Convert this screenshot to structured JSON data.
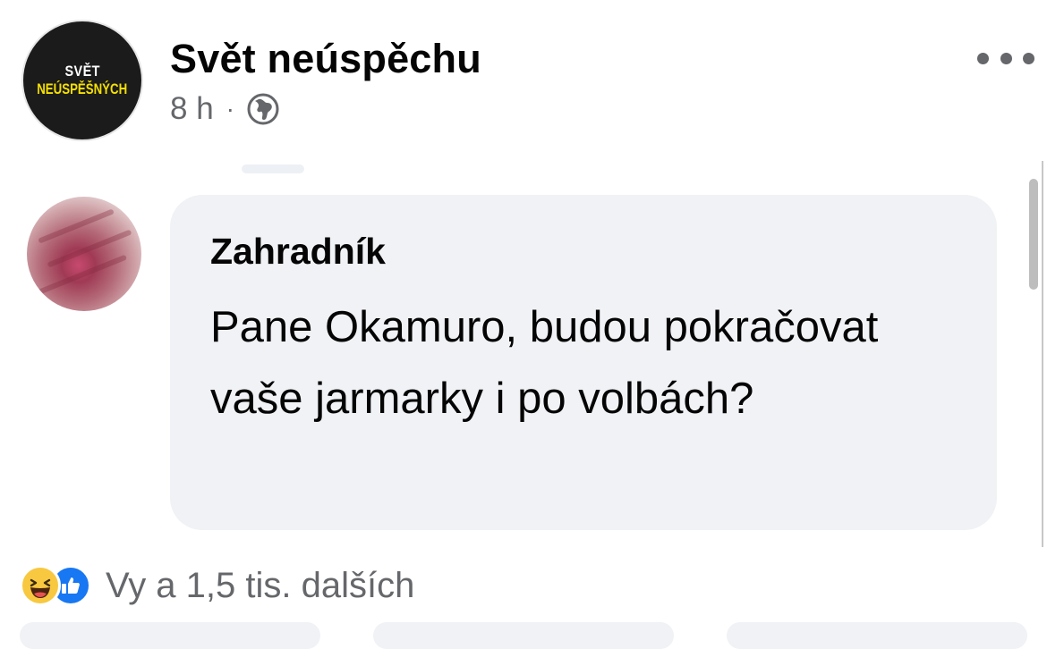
{
  "post": {
    "page_name": "Svět neúspěchu",
    "logo": {
      "line1": "SVĚT",
      "line2": "NEÚSPĚŠNÝCH"
    },
    "time": "8 h",
    "separator": "·",
    "audience_icon": "globe-icon",
    "more_icon": "more-horizontal-icon"
  },
  "comment": {
    "author": "Zahradník",
    "text": "Pane Okamuro, budou pokračovat vaše jarmarky i po volbách?"
  },
  "reactions": {
    "icons": [
      "haha-icon",
      "like-icon"
    ],
    "summary": "Vy a 1,5 tis. dalších"
  },
  "colors": {
    "secondary_text": "#65676b",
    "bubble": "#f0f2f5",
    "like_blue": "#1877f2",
    "logo_yellow": "#f5e000"
  }
}
